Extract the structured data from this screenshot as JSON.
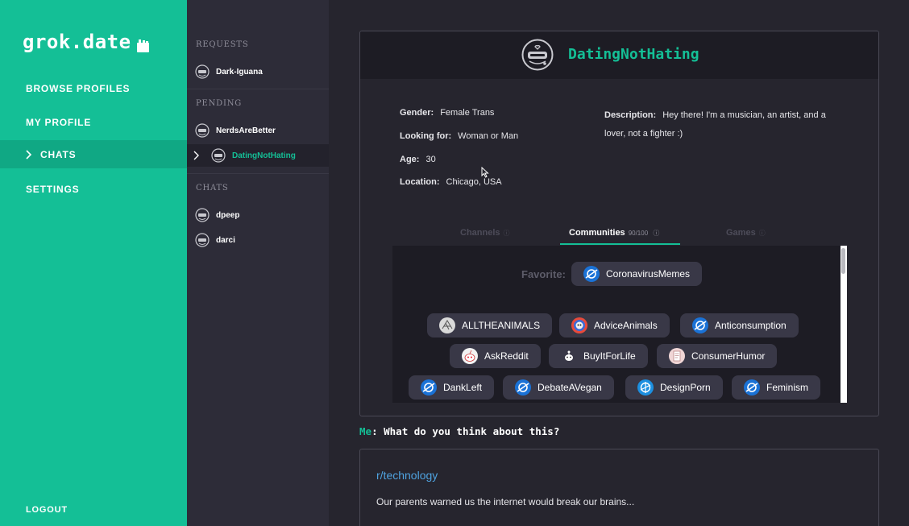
{
  "app": {
    "logo": "grok.date"
  },
  "nav": {
    "items": [
      {
        "label": "BROWSE PROFILES"
      },
      {
        "label": "MY PROFILE"
      },
      {
        "label": "CHATS"
      },
      {
        "label": "SETTINGS"
      }
    ],
    "logout": "LOGOUT"
  },
  "chats": {
    "requests_label": "REQUESTS",
    "requests": [
      {
        "name": "Dark-Iguana"
      }
    ],
    "pending_label": "PENDING",
    "pending": [
      {
        "name": "NerdsAreBetter"
      },
      {
        "name": "DatingNotHating"
      }
    ],
    "chats_label": "CHATS",
    "chats": [
      {
        "name": "dpeep"
      },
      {
        "name": "darci"
      }
    ]
  },
  "profile": {
    "name": "DatingNotHating",
    "fields": {
      "gender_label": "Gender:",
      "gender": "Female Trans",
      "looking_label": "Looking for:",
      "looking": "Woman or Man",
      "age_label": "Age:",
      "age": "30",
      "location_label": "Location:",
      "location": "Chicago, USA",
      "description_label": "Description:",
      "description": "Hey there! I'm a musician, an artist, and a lover, not a fighter :)"
    },
    "tabs": [
      {
        "label": "Channels",
        "count": ""
      },
      {
        "label": "Communities",
        "count": "90/100"
      },
      {
        "label": "Games",
        "count": ""
      }
    ],
    "favorite_label": "Favorite:",
    "favorite": "CoronavirusMemes",
    "communities": [
      "ALLTHEANIMALS",
      "AdviceAnimals",
      "Anticonsumption",
      "AskReddit",
      "BuyItForLife",
      "ConsumerHumor",
      "DankLeft",
      "DebateAVegan",
      "DesignPorn",
      "Feminism"
    ]
  },
  "message": {
    "sender": "Me",
    "text": ": What do you think about this?"
  },
  "post": {
    "subreddit": "r/technology",
    "title": "Our parents warned us the internet would break our brains..."
  },
  "colors": {
    "accent": "#14bf96",
    "link": "#4fa3e0"
  }
}
